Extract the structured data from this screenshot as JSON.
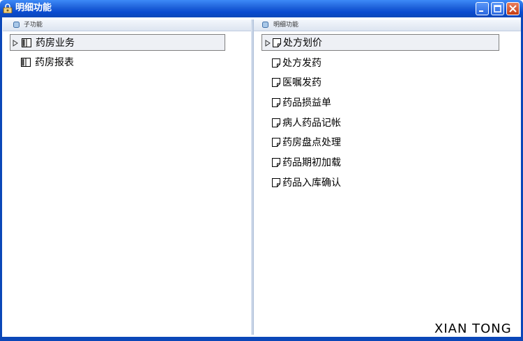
{
  "window": {
    "title": "明细功能",
    "title_bar_color": "#1d5fd8",
    "icons": {
      "app": "lock-person-icon",
      "minimize": "minimize-icon",
      "maximize": "maximize-icon",
      "close": "close-icon"
    }
  },
  "left_pane": {
    "header": "子功能",
    "items": [
      {
        "label": "药房业务",
        "icon": "book-icon",
        "selected": true
      },
      {
        "label": "药房报表",
        "icon": "book-icon",
        "selected": false
      }
    ]
  },
  "right_pane": {
    "header": "明细功能",
    "items": [
      {
        "label": "处方划价",
        "icon": "document-icon",
        "selected": true
      },
      {
        "label": "处方发药",
        "icon": "document-icon",
        "selected": false
      },
      {
        "label": "医嘱发药",
        "icon": "document-icon",
        "selected": false
      },
      {
        "label": "药品损益单",
        "icon": "document-icon",
        "selected": false
      },
      {
        "label": "病人药品记帐",
        "icon": "document-icon",
        "selected": false
      },
      {
        "label": "药房盘点处理",
        "icon": "document-icon",
        "selected": false
      },
      {
        "label": "药品期初加载",
        "icon": "document-icon",
        "selected": false
      },
      {
        "label": "药品入库确认",
        "icon": "document-icon",
        "selected": false
      }
    ]
  },
  "watermark": "XIAN TONG"
}
